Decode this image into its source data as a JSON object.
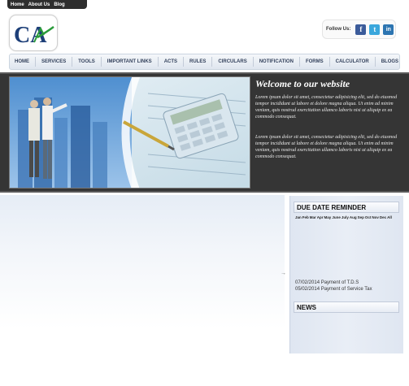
{
  "topbar": {
    "links": [
      "Home",
      "About Us",
      "Blog"
    ]
  },
  "logo": {
    "text": "CA"
  },
  "social": {
    "follow_label": "Follow Us:",
    "icons": [
      {
        "name": "facebook-icon",
        "glyph": "f",
        "color": "#3b5b9a"
      },
      {
        "name": "twitter-icon",
        "glyph": "t",
        "color": "#3aa7dc"
      },
      {
        "name": "linkedin-icon",
        "glyph": "in",
        "color": "#2d75b1"
      }
    ]
  },
  "nav": {
    "items": [
      "HOME",
      "SERVICES",
      "TOOLS",
      "IMPORTANT LINKS",
      "ACTS",
      "RULES",
      "CIRCULARS",
      "NOTIFICATION",
      "FORMS",
      "CALCULATOR",
      "BLOGS"
    ]
  },
  "banner": {
    "heading": "Welcome to our website",
    "paragraphs": [
      "Lorem ipsum dolor sit amet, consectetur adipisicing elit, sed do eiusmod tempor incididunt ut labore et dolore magna aliqua. Ut enim ad minim veniam, quis nostrud exercitation ullamco laboris nisi ut aliquip ex ea commodo consequat.",
      "Lorem ipsum dolor sit amet, consectetur adipisicing elit, sed do eiusmod tempor incididunt ut labore et dolore magna aliqua. Ut enim ad minim veniam, quis nostrud exercitation ullamco laboris nisi ut aliquip ex ea commodo consequat."
    ]
  },
  "sidebar": {
    "due_title": "DUE DATE REMINDER",
    "months": [
      "Jan",
      "Feb",
      "Mar",
      "Apr",
      "May",
      "June",
      "July",
      "Aug",
      "Sep",
      "Oct",
      "Nov",
      "Dec",
      "All"
    ],
    "reminders": [
      "07/02/2014 Payment of T.D.S",
      "05/02/2014 Payment of Service Tax"
    ],
    "news_title": "NEWS"
  },
  "colors": {
    "accent": "#2d75b1",
    "banner_bg": "#353535"
  }
}
